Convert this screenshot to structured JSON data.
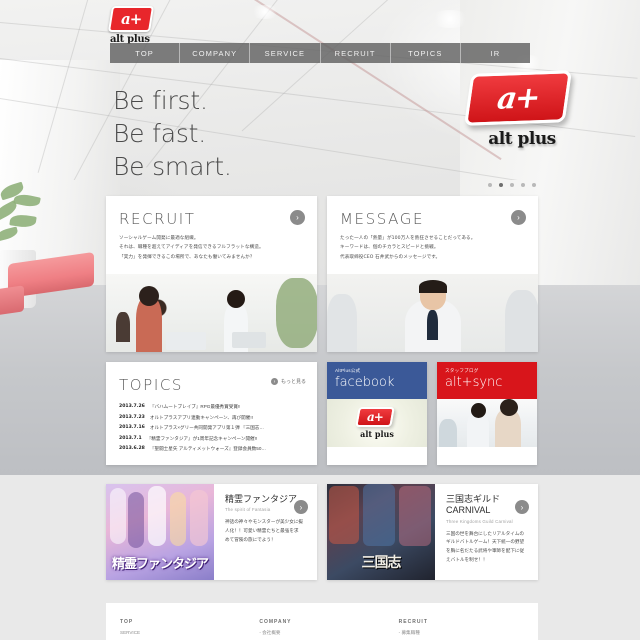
{
  "brand": {
    "mark": "a+",
    "name": "alt plus"
  },
  "nav": {
    "items": [
      "TOP",
      "COMPANY",
      "SERVICE",
      "RECRUIT",
      "TOPICS",
      "IR"
    ]
  },
  "hero": {
    "lines": [
      "Be first.",
      "Be fast.",
      "Be smart."
    ],
    "logo_mark": "a+",
    "logo_text": "alt plus",
    "dots": 5,
    "active_dot": 1
  },
  "cards": {
    "recruit": {
      "title": "RECRUIT",
      "arrow": "›",
      "lines": [
        "ソーシャルゲーム開発に最適な組織。",
        "それは、職種を超えてアイディアを発信できるフルフラットな構造。",
        "「実力」を発揮できるこの場所で、あなたも働いてみませんか？"
      ]
    },
    "message": {
      "title": "MESSAGE",
      "arrow": "›",
      "lines": [
        "たった一人の「熱量」が100万人を熱狂させることだってある。",
        "キーワードは、個のチカラとスピードと挑戦。",
        "代表取締役CEO 石井武からのメッセージです。"
      ]
    },
    "topics": {
      "title": "TOPICS",
      "more_label": "もっと見る",
      "more_icon": "›",
      "items": [
        {
          "date": "2013.7.26",
          "text": "『バハムートブレイブ』RPG最優秀賞受賞!!"
        },
        {
          "date": "2013.7.23",
          "text": "オルトプラスアプリ連動キャンペーン、再び開催!!"
        },
        {
          "date": "2013.7.16",
          "text": "オルトプラス×グリー共同開発アプリ第１弾 『三国志…"
        },
        {
          "date": "2013.7.1",
          "text": "『精霊ファンタジア』が1周年記念キャンペーン開催!!"
        },
        {
          "date": "2013.6.28",
          "text": "『聖闘士星矢 アルティメットウォーズ』登録会員数50…"
        }
      ]
    }
  },
  "social": [
    {
      "kicker": "AltPlus公式",
      "name": "facebook",
      "theme": "fb"
    },
    {
      "kicker": "スタッフブログ",
      "name": "alt+sync",
      "theme": "sy"
    }
  ],
  "games": [
    {
      "art_text": "精霊ファンタジア",
      "title": "精霊ファンタジア",
      "subtitle": "The spirit of Fantasia",
      "arrow": "›",
      "desc": [
        "神話の神々やモンスターが美少女に擬",
        "人化！！可愛い精霊たちと最強を求",
        "めて冒険の旅にでよう！"
      ]
    },
    {
      "art_text": "三国志",
      "title_1": "三国志ギルド",
      "title_2": "CARNIVAL",
      "subtitle": "Three Kingdoms Guild Carnival",
      "arrow": "›",
      "desc": [
        "三国の世を舞台にしたリアルタイムの",
        "ギルドバトルゲーム！天下統一の野望",
        "を胸に名だたる武将や軍師を配下に従",
        "えバトルを制せ！！"
      ]
    }
  ],
  "footer": {
    "columns": [
      {
        "heading": "TOP",
        "links": [
          "SERVICE"
        ]
      },
      {
        "heading": "COMPANY",
        "links": [
          "- 会社概要"
        ]
      },
      {
        "heading": "RECRUIT",
        "links": [
          "- 募集職種"
        ]
      }
    ]
  },
  "colors": {
    "brand_red": "#d8151b",
    "facebook_blue": "#3b5998",
    "nav_bg": "#626262",
    "band_bg": "#e9e9e9"
  }
}
